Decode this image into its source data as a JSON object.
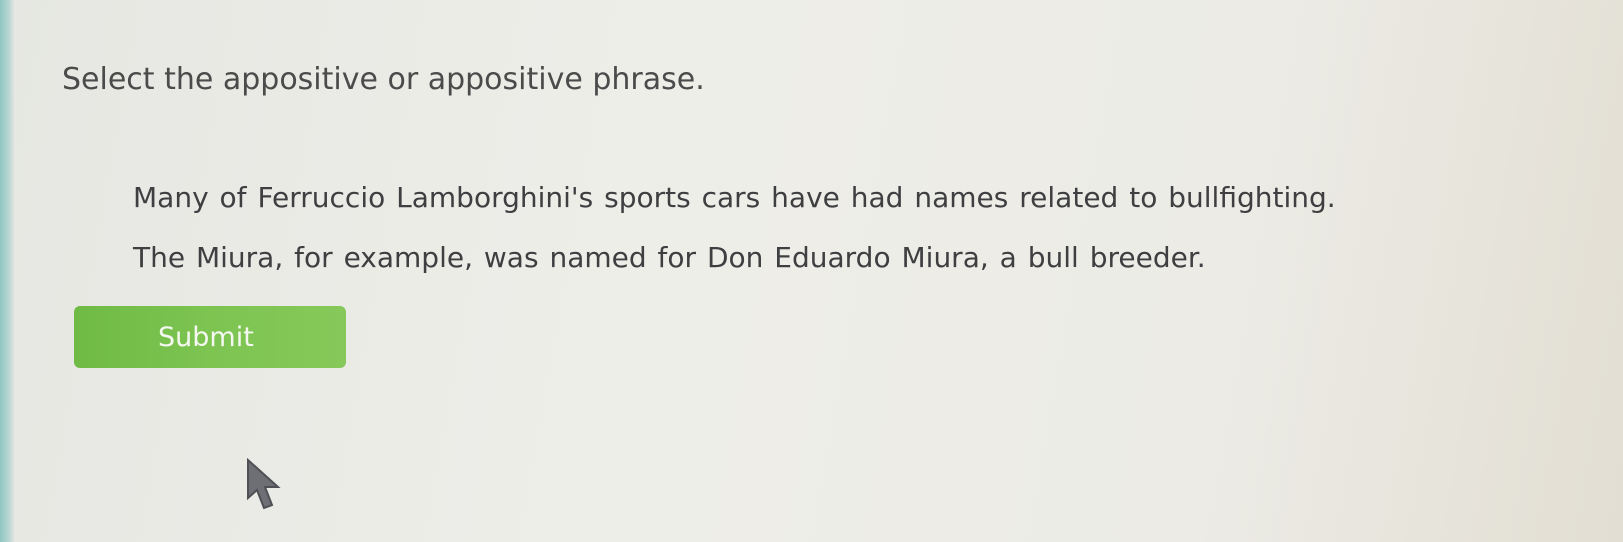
{
  "question": {
    "prompt": "Select the appositive or appositive phrase."
  },
  "passage": {
    "lines": [
      [
        "Many",
        "of",
        "Ferruccio",
        "Lamborghini's",
        "sports",
        "cars",
        "have",
        "had",
        "names",
        "related",
        "to",
        "bullfighting."
      ],
      [
        "The",
        "Miura,",
        "for",
        "example,",
        "was",
        "named",
        "for",
        "Don",
        "Eduardo",
        "Miura,",
        "a",
        "bull",
        "breeder."
      ]
    ]
  },
  "actions": {
    "submit_label": "Submit"
  },
  "colors": {
    "submit_button": "#7dc451",
    "left_accent": "#8fc6c2"
  }
}
